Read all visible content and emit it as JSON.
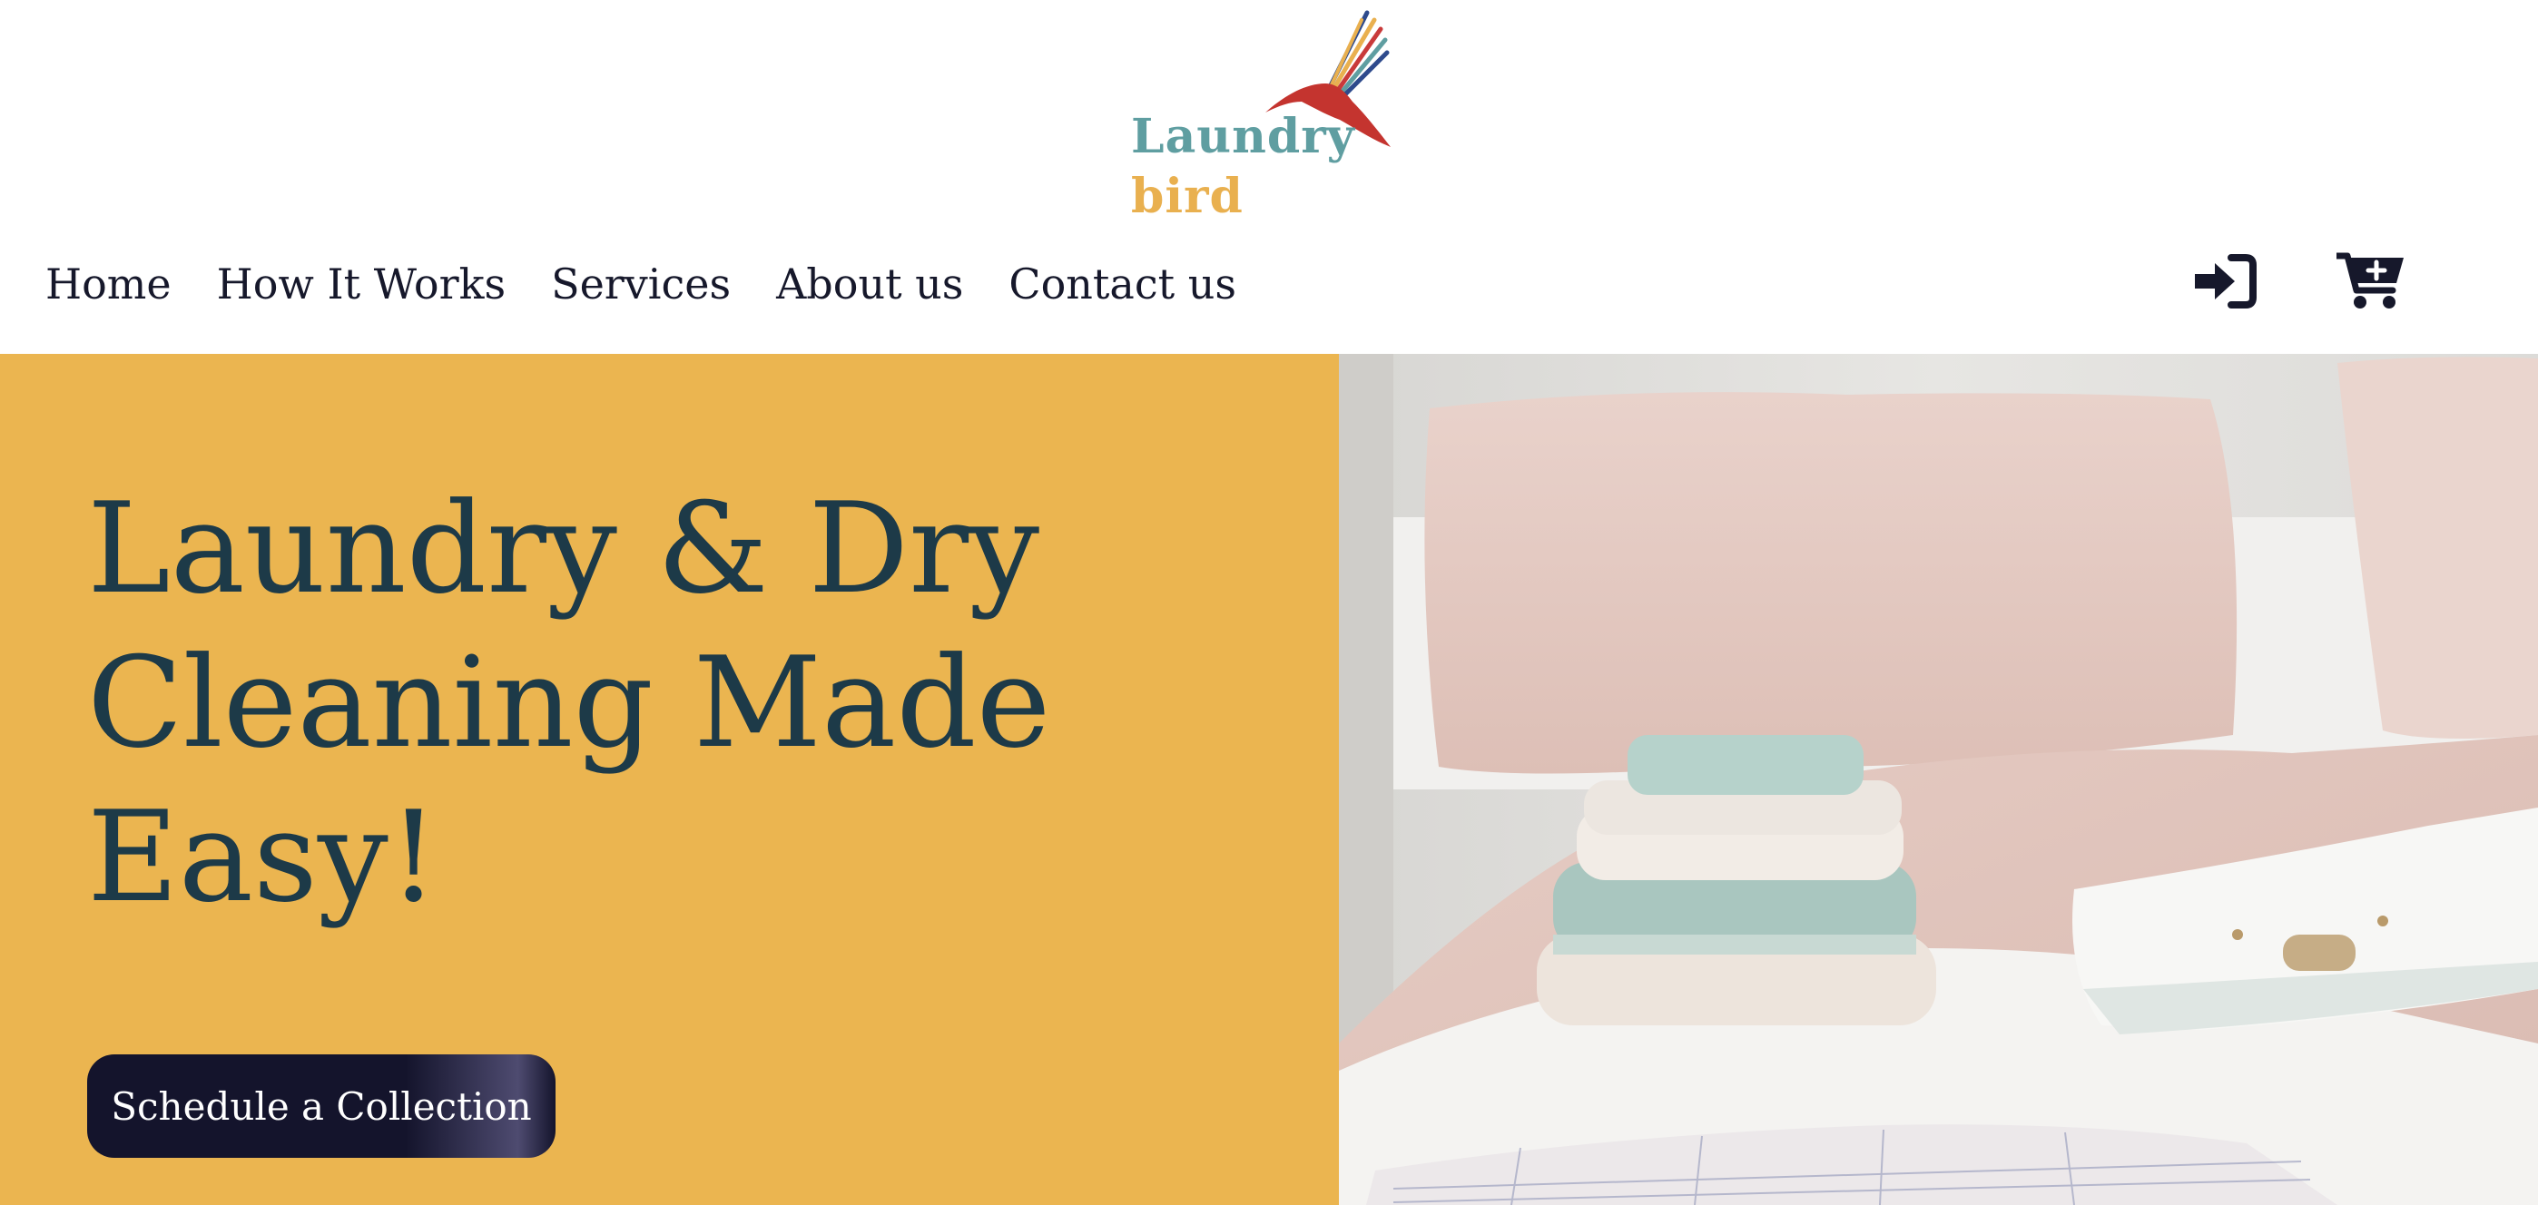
{
  "brand": {
    "word1": "Laundry",
    "word2": "bird",
    "word1_color": "#5f9ea1",
    "word2_color": "#e9b04f"
  },
  "nav": {
    "items": [
      {
        "label": "Home"
      },
      {
        "label": "How It Works"
      },
      {
        "label": "Services"
      },
      {
        "label": "About us"
      },
      {
        "label": "Contact us"
      }
    ]
  },
  "header_icons": {
    "login": "login-icon",
    "cart": "cart-plus-icon"
  },
  "hero": {
    "title": "Laundry & Dry Cleaning Made Easy!",
    "cta_label": "Schedule a Collection",
    "image": "folded-towels-and-shirt-on-bed-photo"
  },
  "colors": {
    "hero_bg": "#ebb550",
    "title_color": "#1d3a48",
    "cta_bg": "#14142c",
    "cta_text": "#ffffff",
    "nav_text": "#16182b",
    "icon_color": "#16182b"
  }
}
